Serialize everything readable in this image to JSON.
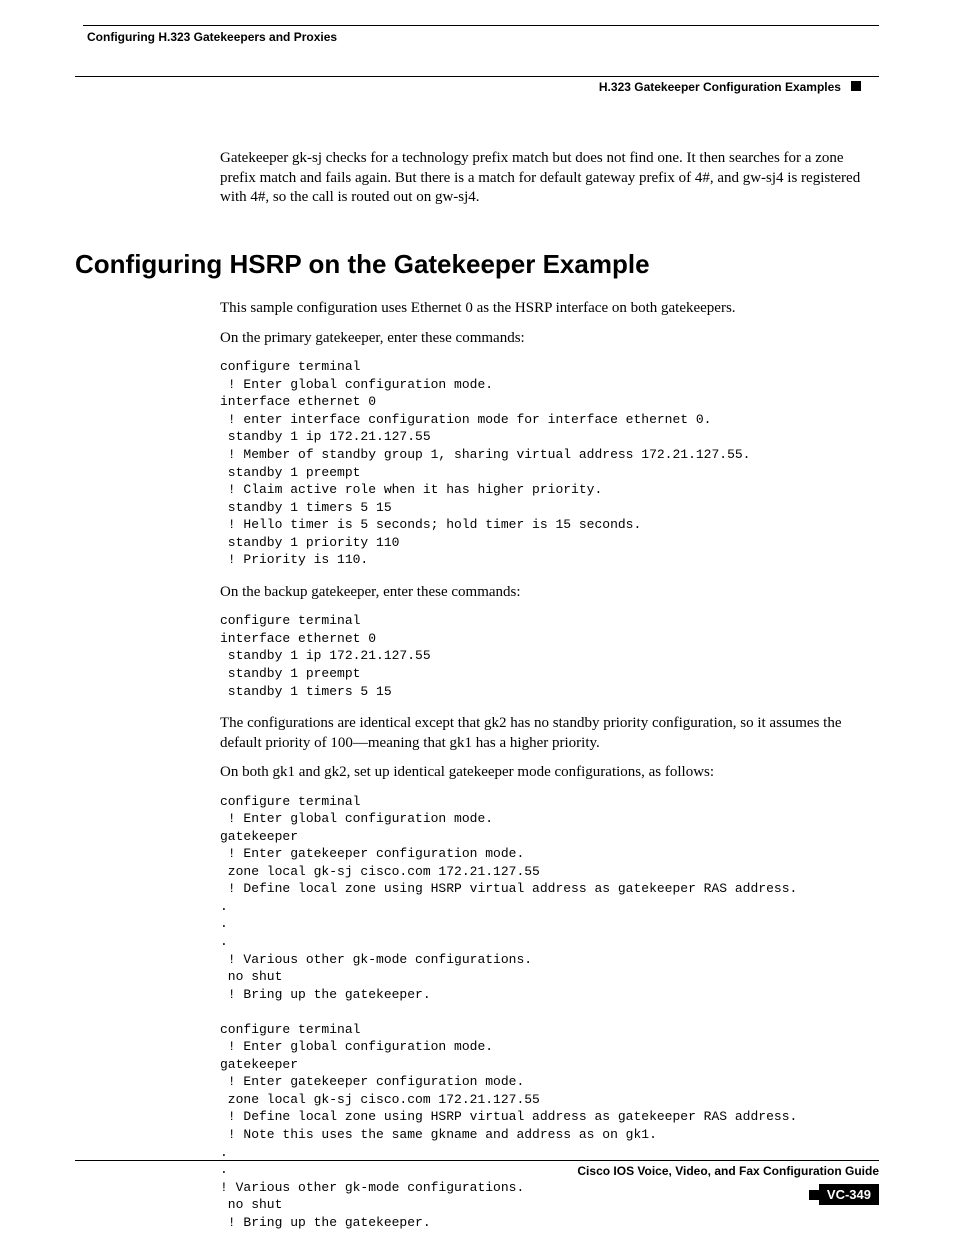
{
  "header": {
    "left": "Configuring H.323 Gatekeepers and Proxies",
    "right": "H.323 Gatekeeper Configuration Examples"
  },
  "intro_para": "Gatekeeper gk-sj checks for a technology prefix match but does not find one. It then searches for a zone prefix match and fails again. But there is a match for default gateway prefix of 4#, and gw-sj4 is registered with 4#, so the call is routed out on gw-sj4.",
  "section_title": "Configuring HSRP on the Gatekeeper Example",
  "p1": "This sample configuration uses Ethernet 0 as the HSRP interface on both gatekeepers.",
  "p2": "On the primary gatekeeper, enter these commands:",
  "code1": "configure terminal\n ! Enter global configuration mode.\ninterface ethernet 0\n ! enter interface configuration mode for interface ethernet 0.\n standby 1 ip 172.21.127.55\n ! Member of standby group 1, sharing virtual address 172.21.127.55.\n standby 1 preempt\n ! Claim active role when it has higher priority.\n standby 1 timers 5 15\n ! Hello timer is 5 seconds; hold timer is 15 seconds.\n standby 1 priority 110\n ! Priority is 110.",
  "p3": "On the backup gatekeeper, enter these commands:",
  "code2": "configure terminal\ninterface ethernet 0\n standby 1 ip 172.21.127.55\n standby 1 preempt\n standby 1 timers 5 15",
  "p4": "The configurations are identical except that gk2 has no standby priority configuration, so it assumes the default priority of 100—meaning that gk1 has a higher priority.",
  "p5": "On both gk1 and gk2, set up identical gatekeeper mode configurations, as follows:",
  "code3": "configure terminal\n ! Enter global configuration mode.\ngatekeeper\n ! Enter gatekeeper configuration mode.\n zone local gk-sj cisco.com 172.21.127.55\n ! Define local zone using HSRP virtual address as gatekeeper RAS address.\n.\n.\n.\n ! Various other gk-mode configurations.\n no shut\n ! Bring up the gatekeeper.\n\nconfigure terminal\n ! Enter global configuration mode.\ngatekeeper\n ! Enter gatekeeper configuration mode.\n zone local gk-sj cisco.com 172.21.127.55\n ! Define local zone using HSRP virtual address as gatekeeper RAS address.\n ! Note this uses the same gkname and address as on gk1.\n.\n.\n! Various other gk-mode configurations.\n no shut\n ! Bring up the gatekeeper.",
  "footer": {
    "title": "Cisco IOS Voice, Video, and Fax Configuration Guide",
    "page": "VC-349"
  }
}
